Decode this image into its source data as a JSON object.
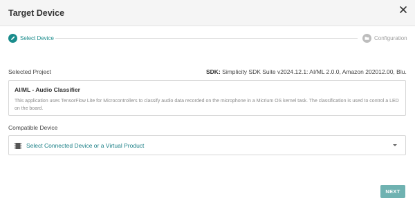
{
  "dialog": {
    "title": "Target Device",
    "close_icon": "close-icon"
  },
  "stepper": {
    "steps": [
      {
        "label": "Select Device",
        "state": "active",
        "icon": "pencil-icon"
      },
      {
        "label": "Configuration",
        "state": "inactive",
        "icon": "folder-icon"
      }
    ]
  },
  "project": {
    "section_label": "Selected Project",
    "sdk_label": "SDK:",
    "sdk_value": "Simplicity SDK Suite v2024.12.1: AI/ML 2.0.0, Amazon 202012.00, Blu...",
    "name": "AI/ML - Audio Classifier",
    "description": "This application uses TensorFlow Lite for Microcontrollers to classify audio data recorded on the microphone in a Micrium OS kernel task. The classification is used to control a LED on the board."
  },
  "device": {
    "section_label": "Compatible Device",
    "select_text": "Select Connected Device or a Virtual Product",
    "icon": "chip-icon"
  },
  "footer": {
    "next_label": "NEXT"
  },
  "colors": {
    "accent": "#1a8c8c",
    "link": "#1a7f86",
    "button": "#6fb2b1",
    "inactive": "#bdbdbd"
  }
}
